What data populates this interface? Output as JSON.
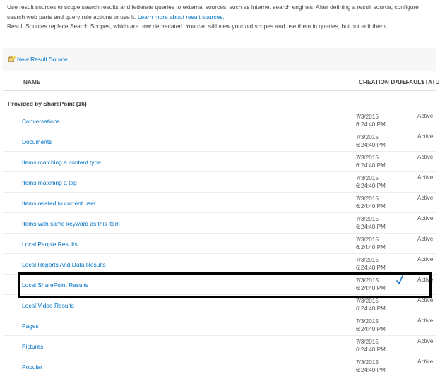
{
  "intro": {
    "line1": "Use result sources to scope search results and federate queries to external sources, such as internet search engines. After defining a result source, configure search web parts and query rule actions to use it.",
    "learn_more_link": "Learn more about result sources.",
    "line2": "Result Sources replace Search Scopes, which are now deprecated. You can still view your old scopes and use them in queries, but not edit them."
  },
  "toolbar": {
    "new_result_source_label": "New Result Source",
    "new_result_source_icon": "new-item-icon"
  },
  "table": {
    "headers": {
      "name": "NAME",
      "creation_date": "CREATION DATE",
      "default": "DEFAULT",
      "status": "STATUS"
    },
    "group_label": "Provided by SharePoint (16)",
    "rows": [
      {
        "name": "Conversations",
        "date_line1": "7/3/2015",
        "date_line2": "6:24:40 PM",
        "status": "Active",
        "default": false
      },
      {
        "name": "Documents",
        "date_line1": "7/3/2015",
        "date_line2": "6:24:40 PM",
        "status": "Active",
        "default": false
      },
      {
        "name": "Items matching a content type",
        "date_line1": "7/3/2015",
        "date_line2": "6:24:40 PM",
        "status": "Active",
        "default": false
      },
      {
        "name": "Items matching a tag",
        "date_line1": "7/3/2015",
        "date_line2": "6:24:40 PM",
        "status": "Active",
        "default": false
      },
      {
        "name": "Items related to current user",
        "date_line1": "7/3/2015",
        "date_line2": "6:24:40 PM",
        "status": "Active",
        "default": false
      },
      {
        "name": "Items with same keyword as this item",
        "date_line1": "7/3/2015",
        "date_line2": "6:24:40 PM",
        "status": "Active",
        "default": false
      },
      {
        "name": "Local People Results",
        "date_line1": "7/3/2015",
        "date_line2": "6:24:40 PM",
        "status": "Active",
        "default": false
      },
      {
        "name": "Local Reports And Data Results",
        "date_line1": "7/3/2015",
        "date_line2": "6:24:40 PM",
        "status": "Active",
        "default": false
      },
      {
        "name": "Local SharePoint Results",
        "date_line1": "7/3/2015",
        "date_line2": "6:24:40 PM",
        "status": "Active",
        "default": true
      },
      {
        "name": "Local Video Results",
        "date_line1": "7/3/2015",
        "date_line2": "6:24:40 PM",
        "status": "Active",
        "default": false
      },
      {
        "name": "Pages",
        "date_line1": "7/3/2015",
        "date_line2": "6:24:40 PM",
        "status": "Active",
        "default": false
      },
      {
        "name": "Pictures",
        "date_line1": "7/3/2015",
        "date_line2": "6:24:40 PM",
        "status": "Active",
        "default": false
      },
      {
        "name": "Popular",
        "date_line1": "7/3/2015",
        "date_line2": "6:24:40 PM",
        "status": "Active",
        "default": false
      }
    ],
    "default_check_icon": "checkmark-icon"
  },
  "colors": {
    "link": "#0072c6",
    "text": "#444444",
    "toolbar_bg": "#f7f7f7",
    "check": "#1e6fc8",
    "highlight_border": "#000000"
  }
}
